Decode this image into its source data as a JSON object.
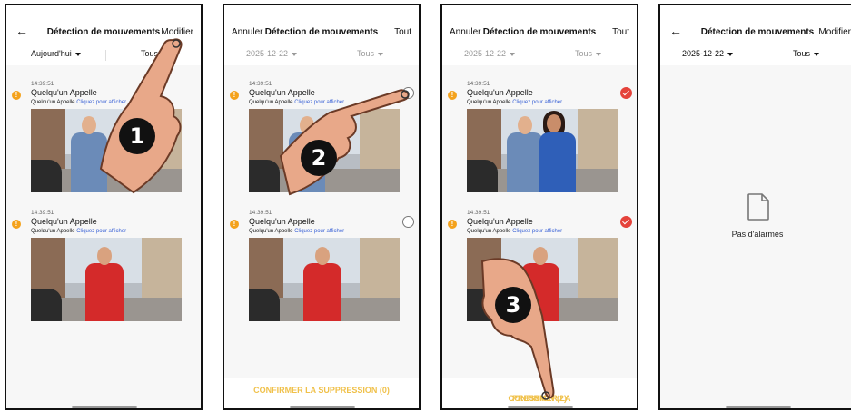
{
  "screens": {
    "s1": {
      "title": "Détection de mouvements",
      "right_action": "Modifier",
      "filter_date": "Aujourd'hui",
      "filter_type": "Tous",
      "entries": [
        {
          "time": "14:39:51",
          "caller": "Quelqu'un Appelle",
          "sub": "Quelqu'un Appelle",
          "link": "Cliquez pour afficher"
        },
        {
          "time": "14:39:51",
          "caller": "Quelqu'un Appelle",
          "sub": "Quelqu'un Appelle",
          "link": "Cliquez pour afficher"
        }
      ],
      "step": "1"
    },
    "s2": {
      "title": "Détection de mouvements",
      "left_action": "Annuler",
      "right_action": "Tout",
      "filter_date": "2025-12-22",
      "filter_type": "Tous",
      "entries": [
        {
          "time": "14:39:51",
          "caller": "Quelqu'un Appelle",
          "sub": "Quelqu'un Appelle",
          "link": "Cliquez pour afficher"
        },
        {
          "time": "14:39:51",
          "caller": "Quelqu'un Appelle",
          "sub": "Quelqu'un Appelle",
          "link": "Cliquez pour afficher"
        }
      ],
      "confirm": "CONFIRMER LA SUPPRESSION (0)",
      "step": "2"
    },
    "s3": {
      "title": "Détection de mouvements",
      "left_action": "Annuler",
      "right_action": "Tout",
      "filter_date": "2025-12-22",
      "filter_type": "Tous",
      "entries": [
        {
          "time": "14:39:51",
          "caller": "Quelqu'un Appelle",
          "sub": "Quelqu'un Appelle",
          "link": "Cliquez pour afficher"
        },
        {
          "time": "14:39:51",
          "caller": "Quelqu'un Appelle",
          "sub": "Quelqu'un Appelle",
          "link": "Cliquez pour afficher"
        }
      ],
      "confirm_left": "CONFIRMER LA ",
      "confirm_right": "PRESSION (2)",
      "step": "3"
    },
    "s4": {
      "title": "Détection de mouvements",
      "right_action": "Modifier",
      "filter_date": "2025-12-22",
      "filter_type": "Tous",
      "empty": "Pas d'alarmes"
    }
  },
  "colors": {
    "badge": "#f4a21c",
    "link": "#3a62d6",
    "selected": "#e5433b",
    "confirm": "#f0c14b"
  },
  "icons": {
    "back": "arrow-left-icon",
    "empty": "document-icon",
    "hand": "pointing-hand-icon"
  }
}
